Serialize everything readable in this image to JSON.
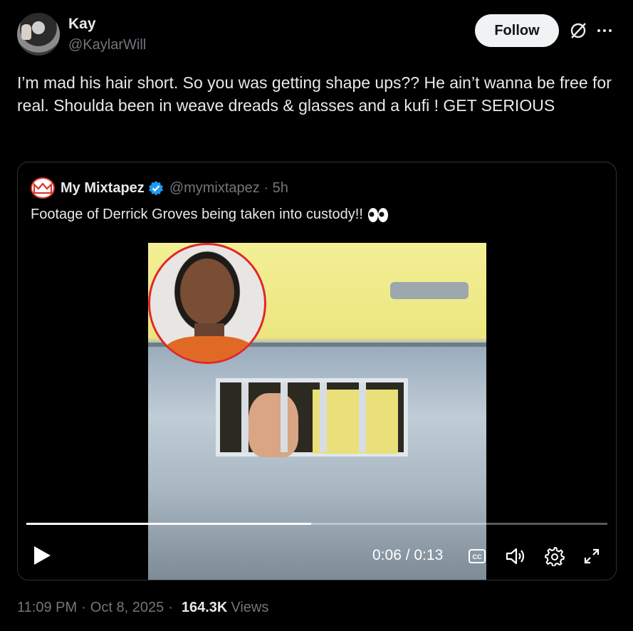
{
  "author": {
    "name": "Kay",
    "handle": "@KaylarWill",
    "follow_label": "Follow"
  },
  "tweet": {
    "text": "I’m mad his hair short. So you was getting shape ups?? He ain’t wanna be free for real. Shoulda been in weave dreads & glasses and a kufi ! GET SERIOUS"
  },
  "quote": {
    "logo_text": "MM",
    "name": "My Mixtapez",
    "handle_time": "@mymixtapez · 5h",
    "text": "Footage of Derrick Groves being taken into custody!!",
    "emoji_icon": "eyes-icon"
  },
  "video": {
    "time": "0:06 / 0:13",
    "progress_fraction": 0.49,
    "icons": [
      "play-icon",
      "closed-captions-icon",
      "volume-icon",
      "gear-icon",
      "expand-icon"
    ]
  },
  "meta": {
    "time": "11:09 PM",
    "date": "Oct 8, 2025",
    "views_count": "164.3K",
    "views_label": "Views"
  },
  "colors": {
    "background": "#000000",
    "text": "#e7e9ea",
    "muted": "#71767b",
    "verified": "#1d9bf0",
    "border": "#2f3336",
    "follow_bg": "#eff3f4"
  }
}
